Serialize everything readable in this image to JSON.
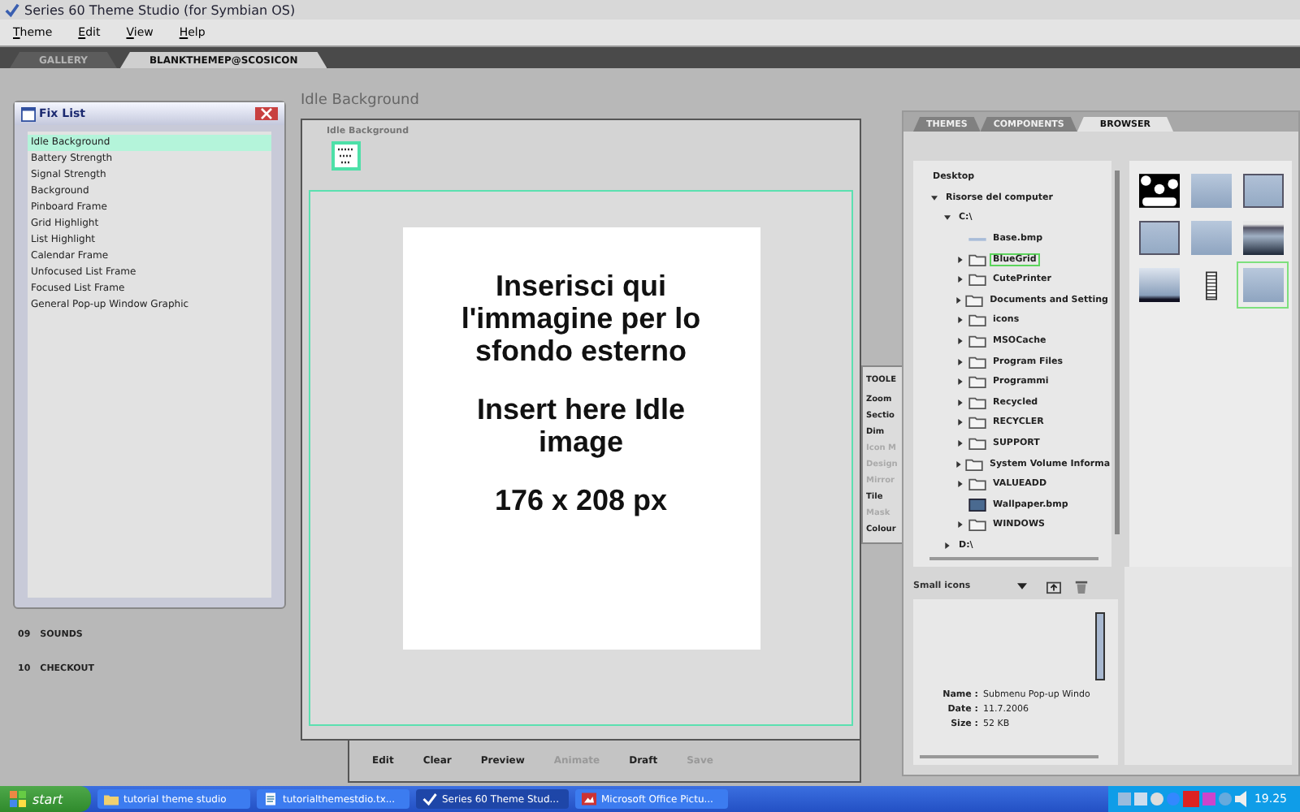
{
  "window": {
    "title": "Series 60 Theme Studio (for Symbian OS)"
  },
  "menu": [
    {
      "label": "Theme"
    },
    {
      "label": "Edit"
    },
    {
      "label": "View"
    },
    {
      "label": "Help"
    }
  ],
  "doc_tabs": [
    {
      "label": "GALLERY",
      "selected": false
    },
    {
      "label": "BLANKTHEMEP@SCOSICON",
      "selected": true
    }
  ],
  "fix_list": {
    "title": "Fix List",
    "items": [
      {
        "label": "Idle Background",
        "selected": true
      },
      {
        "label": "Battery Strength",
        "selected": false
      },
      {
        "label": "Signal Strength",
        "selected": false
      },
      {
        "label": "Background",
        "selected": false
      },
      {
        "label": "Pinboard Frame",
        "selected": false
      },
      {
        "label": "Grid Highlight",
        "selected": false
      },
      {
        "label": "List Highlight",
        "selected": false
      },
      {
        "label": "Calendar Frame",
        "selected": false
      },
      {
        "label": "Unfocused List Frame",
        "selected": false
      },
      {
        "label": "Focused List Frame",
        "selected": false
      },
      {
        "label": "General Pop-up Window Graphic",
        "selected": false
      }
    ]
  },
  "sections": [
    {
      "number": "09",
      "label": "SOUNDS"
    },
    {
      "number": "10",
      "label": "CHECKOUT"
    }
  ],
  "editor": {
    "title": "Idle Background",
    "subtitle": "Idle Background",
    "image_text": [
      "Inserisci qui l'immagine per lo sfondo esterno",
      "Insert here Idle image",
      "176 x 208 px"
    ],
    "actions": [
      {
        "label": "Edit",
        "disabled": false
      },
      {
        "label": "Clear",
        "disabled": false
      },
      {
        "label": "Preview",
        "disabled": false
      },
      {
        "label": "Animate",
        "disabled": true
      },
      {
        "label": "Draft",
        "disabled": false
      },
      {
        "label": "Save",
        "disabled": true
      }
    ]
  },
  "tools": {
    "title": "TOOLE",
    "items": [
      {
        "label": "Zoom",
        "disabled": false
      },
      {
        "label": "Sectio",
        "disabled": false
      },
      {
        "label": "Dim",
        "disabled": false
      },
      {
        "label": "Icon M",
        "disabled": true
      },
      {
        "label": "Design",
        "disabled": true
      },
      {
        "label": "Mirror",
        "disabled": true
      },
      {
        "label": "Tile",
        "disabled": false
      },
      {
        "label": "Mask",
        "disabled": true
      },
      {
        "label": "Colour",
        "disabled": false
      }
    ]
  },
  "browser": {
    "tabs": [
      {
        "label": "THEMES",
        "selected": false
      },
      {
        "label": "COMPONENTS",
        "selected": false
      },
      {
        "label": "BROWSER",
        "selected": true
      }
    ],
    "tree": [
      {
        "label": "Desktop",
        "selected": false,
        "children": [
          {
            "label": "Risorse del computer",
            "expanded": true,
            "selected": false,
            "children": [
              {
                "label": "C:\\",
                "expanded": true,
                "selected": false,
                "children": [
                  {
                    "label": "Base.bmp",
                    "kind": "file",
                    "selected": false
                  },
                  {
                    "label": "BlueGrid",
                    "kind": "folder",
                    "expanded": false,
                    "selected": true
                  },
                  {
                    "label": "CutePrinter",
                    "kind": "folder",
                    "expanded": false,
                    "selected": false
                  },
                  {
                    "label": "Documents and Setting",
                    "kind": "folder",
                    "expanded": false,
                    "selected": false
                  },
                  {
                    "label": "icons",
                    "kind": "folder",
                    "expanded": false,
                    "selected": false
                  },
                  {
                    "label": "MSOCache",
                    "kind": "folder",
                    "expanded": false,
                    "selected": false
                  },
                  {
                    "label": "Program Files",
                    "kind": "folder",
                    "expanded": false,
                    "selected": false
                  },
                  {
                    "label": "Programmi",
                    "kind": "folder",
                    "expanded": false,
                    "selected": false
                  },
                  {
                    "label": "Recycled",
                    "kind": "folder",
                    "expanded": false,
                    "selected": false
                  },
                  {
                    "label": "RECYCLER",
                    "kind": "folder",
                    "expanded": false,
                    "selected": false
                  },
                  {
                    "label": "SUPPORT",
                    "kind": "folder",
                    "expanded": false,
                    "selected": false
                  },
                  {
                    "label": "System Volume Informa",
                    "kind": "folder",
                    "expanded": false,
                    "selected": false
                  },
                  {
                    "label": "VALUEADD",
                    "kind": "folder",
                    "expanded": false,
                    "selected": false
                  },
                  {
                    "label": "Wallpaper.bmp",
                    "kind": "image",
                    "selected": false
                  },
                  {
                    "label": "WINDOWS",
                    "kind": "folder",
                    "expanded": false,
                    "selected": false
                  }
                ]
              },
              {
                "label": "D:\\",
                "expanded": false,
                "selected": false
              }
            ]
          }
        ]
      }
    ],
    "thumbnails": [
      {
        "kind": "dots",
        "selected": false
      },
      {
        "kind": "tile",
        "selected": false
      },
      {
        "kind": "frame",
        "selected": false
      },
      {
        "kind": "frame",
        "selected": false
      },
      {
        "kind": "tile",
        "selected": false
      },
      {
        "kind": "dark",
        "selected": false
      },
      {
        "kind": "fade",
        "selected": false
      },
      {
        "kind": "ladder",
        "selected": false
      },
      {
        "kind": "tile",
        "selected": true
      }
    ],
    "view_mode": "Small icons",
    "info": [
      {
        "label": "Name :",
        "value": "Submenu Pop-up Windo"
      },
      {
        "label": "Date :",
        "value": "11.7.2006"
      },
      {
        "label": "Size :",
        "value": "52 KB"
      }
    ]
  },
  "taskbar": {
    "start": "start",
    "tasks": [
      {
        "label": "tutorial theme studio",
        "kind": "folder",
        "selected": false
      },
      {
        "label": "tutorialthemestdio.tx...",
        "kind": "doc",
        "selected": false
      },
      {
        "label": "Series 60 Theme Stud...",
        "kind": "app",
        "selected": true
      },
      {
        "label": "Microsoft Office Pictu...",
        "kind": "picture",
        "selected": false
      }
    ],
    "clock": "19.25"
  }
}
